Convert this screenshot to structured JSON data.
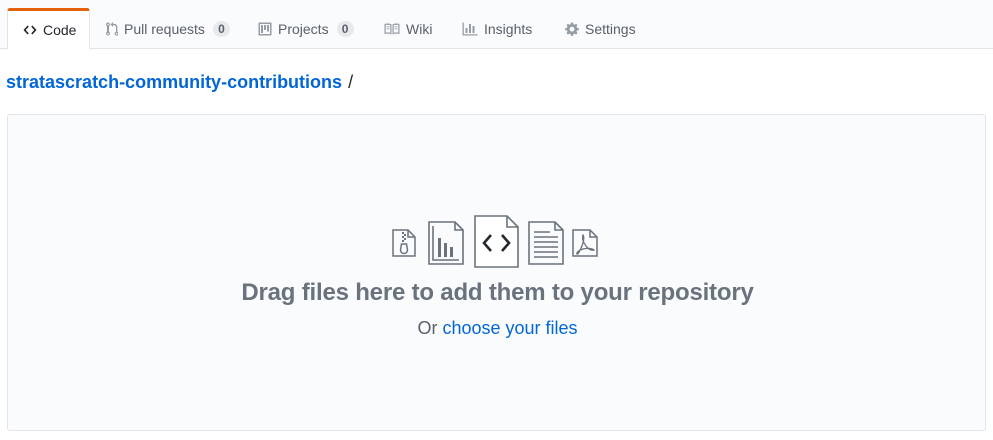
{
  "tabs": [
    {
      "label": "Code",
      "icon": "code-icon",
      "selected": true
    },
    {
      "label": "Pull requests",
      "icon": "pull-request-icon",
      "count": "0"
    },
    {
      "label": "Projects",
      "icon": "project-icon",
      "count": "0"
    },
    {
      "label": "Wiki",
      "icon": "book-icon"
    },
    {
      "label": "Insights",
      "icon": "graph-icon"
    },
    {
      "label": "Settings",
      "icon": "gear-icon"
    }
  ],
  "breadcrumb": {
    "repo": "stratascratch-community-contributions",
    "separator": "/"
  },
  "upload": {
    "headline": "Drag files here to add them to your repository",
    "prompt_prefix": "Or",
    "choose_link": "choose your files",
    "file_icons": [
      "file-zip-icon",
      "file-chart-icon",
      "file-code-icon",
      "file-text-icon",
      "file-pdf-icon"
    ]
  },
  "colors": {
    "accent_orange": "#e36209",
    "link_blue": "#0366d6",
    "muted_text": "#586069",
    "border": "#e1e4e8"
  }
}
